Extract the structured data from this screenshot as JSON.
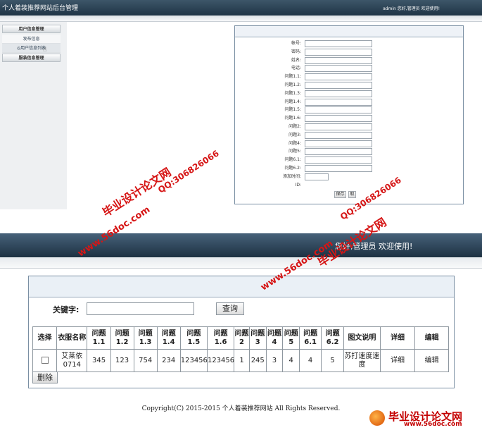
{
  "top_app": {
    "title": "个人着装推荐网站后台管理",
    "welcome": "admin 您好,管理员 欢迎使用!",
    "sidebar": [
      {
        "label": "用户信息管理",
        "type": "head"
      },
      {
        "label": "发布信息",
        "type": "item"
      },
      {
        "label": "◎用户信息列表",
        "type": "item"
      },
      {
        "label": "服装信息管理",
        "type": "head"
      }
    ],
    "form": {
      "fields": [
        "帐号:",
        "密码:",
        "姓名:",
        "电话:",
        "问题1.1:",
        "问题1.2:",
        "问题1.3:",
        "问题1.4:",
        "问题1.5:",
        "问题1.6:",
        "问题2:",
        "问题3:",
        "问题4:",
        "问题5:",
        "问题6.1:",
        "问题6.2:",
        "添加时间:",
        "ID:"
      ],
      "save_label": "保存",
      "reset_label": "取"
    }
  },
  "watermarks": {
    "site_name": "毕业设计论文网",
    "url": "www.56doc.com",
    "qq": "QQ:306826066"
  },
  "bottom_app": {
    "welcome": "您好,管理员 欢迎使用!",
    "keyword_label": "关键字:",
    "keyword_value": "",
    "search_label": "查询",
    "table": {
      "headers": [
        "选择",
        "衣服名称",
        "问题1.1",
        "问题1.2",
        "问题1.3",
        "问题1.4",
        "问题1.5",
        "问题1.6",
        "问题2",
        "问题3",
        "问题4",
        "问题5",
        "问题6.1",
        "问题6.2",
        "图文说明",
        "详细",
        "编辑"
      ],
      "rows": [
        [
          "",
          "艾莱依0714",
          "345",
          "123",
          "754",
          "234",
          "123456",
          "123456",
          "1",
          "245",
          "3",
          "4",
          "4",
          "5",
          "苏打速度速度",
          "详细",
          "编辑"
        ]
      ]
    },
    "delete_label": "删除"
  },
  "footer": "Copyright(C) 2015-2015 个人着装推荐网站 All Rights Reserved.",
  "logo": {
    "name": "毕业设计论文网",
    "url": "www.56doc.com"
  }
}
